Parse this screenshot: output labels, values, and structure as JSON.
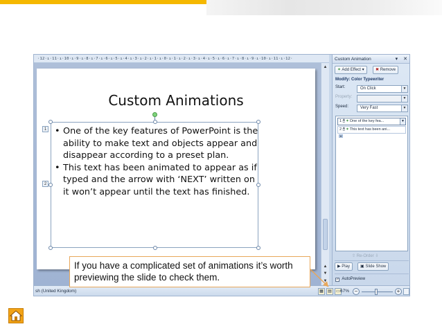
{
  "ruler": {
    "text": "·12·ı·11·ı·10·ı·9·ı·8·ı·7·ı·6·ı·5·ı·4·ı·3·ı·2·ı·1·ı·0·ı·1·ı·2·ı·3·ı·4·ı·5·ı·6·ı·7·ı·8·ı·9·ı·10·ı·11·ı·12·"
  },
  "slide": {
    "title": "Custom Animations",
    "bullets": [
      "One of the key features of PowerPoint is the ability to make text and objects appear and disappear according to a preset plan.",
      "This text has been animated to appear as if typed and the arrow with ‘NEXT’ written on it won’t appear until the text has finished."
    ],
    "anim_tags": [
      "1",
      "2"
    ]
  },
  "task_pane": {
    "title": "Custom Animation",
    "controls": "▾ ✕",
    "add_effect": "Add Effect ▾",
    "remove": "Remove",
    "modify": "Modify: Color Typewriter",
    "start_label": "Start:",
    "start_value": "On Click",
    "property_label": "Property:",
    "property_value": "",
    "speed_label": "Speed:",
    "speed_value": "Very Fast",
    "items": [
      {
        "num": "1",
        "label": "One of the key fea..."
      },
      {
        "num": "2",
        "label": "This text has been ani..."
      }
    ],
    "reorder": "Re-Order",
    "play": "Play",
    "slide_show": "Slide Show",
    "autopreview": "AutoPreview",
    "autopreview_check": "✓"
  },
  "status": {
    "language": "sh (United Kingdom)",
    "zoom": "67%",
    "zoom_level_percent": 67
  },
  "callout": {
    "text": "If you have a complicated set of animations it’s worth previewing the slide to check them."
  },
  "colors": {
    "top_bar": "#f5b800",
    "callout_border": "#e8a75a",
    "home_icon": "#f2a316"
  },
  "icons": {
    "home": "home-icon",
    "add_effect": "star-icon",
    "remove": "remove-icon",
    "play": "play-icon",
    "slide_show": "slideshow-icon"
  }
}
